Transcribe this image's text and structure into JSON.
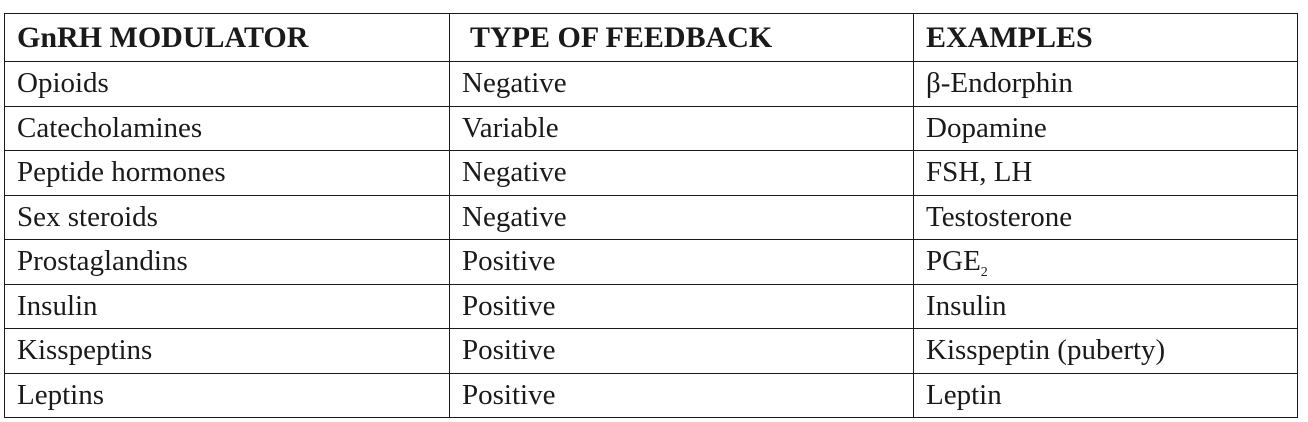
{
  "table": {
    "headers": [
      "GnRH MODULATOR",
      "TYPE OF FEEDBACK",
      "EXAMPLES"
    ],
    "rows": [
      {
        "modulator": "Opioids",
        "feedback": "Negative",
        "example": "β-Endorphin"
      },
      {
        "modulator": "Catecholamines",
        "feedback": "Variable",
        "example": "Dopamine"
      },
      {
        "modulator": "Peptide hormones",
        "feedback": "Negative",
        "example": "FSH, LH"
      },
      {
        "modulator": "Sex steroids",
        "feedback": "Negative",
        "example": "Testosterone"
      },
      {
        "modulator": "Prostaglandins",
        "feedback": "Positive",
        "example": "PGE",
        "example_subscript": "2"
      },
      {
        "modulator": "Insulin",
        "feedback": "Positive",
        "example": "Insulin"
      },
      {
        "modulator": "Kisspeptins",
        "feedback": "Positive",
        "example": "Kisspeptin (puberty)"
      },
      {
        "modulator": "Leptins",
        "feedback": "Positive",
        "example": "Leptin"
      }
    ]
  }
}
